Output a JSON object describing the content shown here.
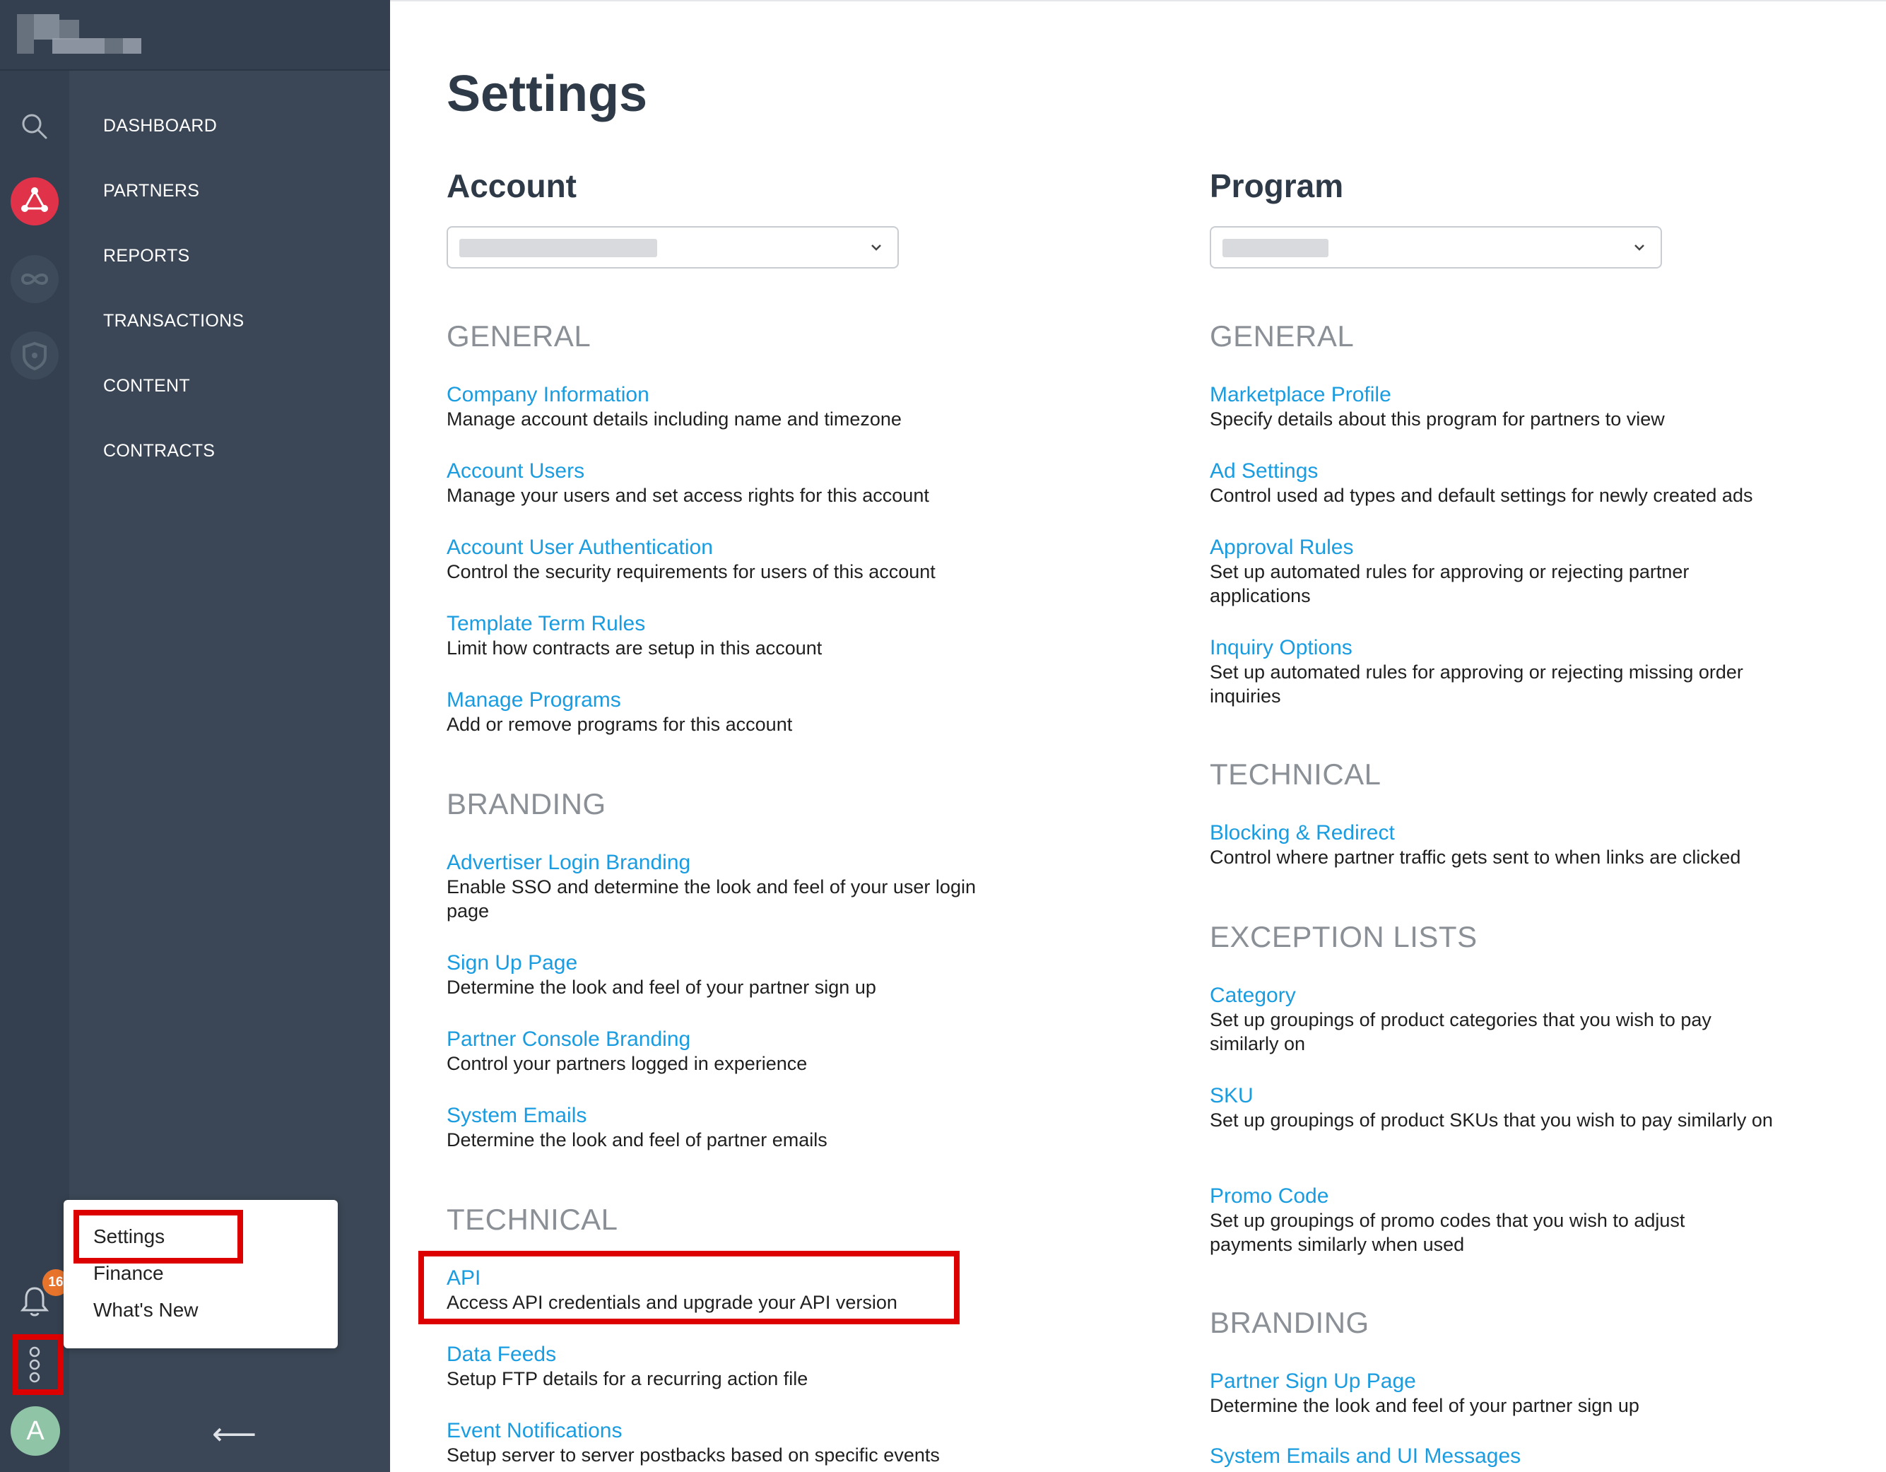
{
  "sidebar": {
    "nav_items": [
      "DASHBOARD",
      "PARTNERS",
      "REPORTS",
      "TRANSACTIONS",
      "CONTENT",
      "CONTRACTS"
    ],
    "notification_count": "16",
    "avatar_letter": "A",
    "collapse_arrow": "⟵",
    "icons": [
      "search-icon",
      "partners-network-icon",
      "infinity-icon",
      "shield-icon",
      "bell-icon",
      "more-options-icon"
    ],
    "accent_color": "#e0334a"
  },
  "popup_menu": {
    "items": [
      "Settings",
      "Finance",
      "What's New"
    ]
  },
  "page": {
    "title": "Settings"
  },
  "account": {
    "title": "Account",
    "sections": [
      {
        "heading": "GENERAL",
        "items": [
          {
            "link": "Company Information",
            "desc": "Manage account details including name and timezone"
          },
          {
            "link": "Account Users",
            "desc": "Manage your users and set access rights for this account"
          },
          {
            "link": "Account User Authentication",
            "desc": "Control the security requirements for users of this account"
          },
          {
            "link": "Template Term Rules",
            "desc": "Limit how contracts are setup in this account"
          },
          {
            "link": "Manage Programs",
            "desc": "Add or remove programs for this account"
          }
        ]
      },
      {
        "heading": "BRANDING",
        "items": [
          {
            "link": "Advertiser Login Branding",
            "desc": "Enable SSO and determine the look and feel of your user login page"
          },
          {
            "link": "Sign Up Page",
            "desc": "Determine the look and feel of your partner sign up"
          },
          {
            "link": "Partner Console Branding",
            "desc": "Control your partners logged in experience"
          },
          {
            "link": "System Emails",
            "desc": "Determine the look and feel of partner emails"
          }
        ]
      },
      {
        "heading": "TECHNICAL",
        "items": [
          {
            "link": "API",
            "desc": "Access API credentials and upgrade your API version"
          },
          {
            "link": "Data Feeds",
            "desc": "Setup FTP details for a recurring action file"
          },
          {
            "link": "Event Notifications",
            "desc": "Setup server to server postbacks based on specific events"
          }
        ]
      }
    ]
  },
  "program": {
    "title": "Program",
    "sections": [
      {
        "heading": "GENERAL",
        "items": [
          {
            "link": "Marketplace Profile",
            "desc": "Specify details about this program for partners to view"
          },
          {
            "link": "Ad Settings",
            "desc": "Control used ad types and default settings for newly created ads"
          },
          {
            "link": "Approval Rules",
            "desc": "Set up automated rules for approving or rejecting partner applications"
          },
          {
            "link": "Inquiry Options",
            "desc": "Set up automated rules for approving or rejecting missing order inquiries"
          }
        ]
      },
      {
        "heading": "TECHNICAL",
        "items": [
          {
            "link": "Blocking & Redirect",
            "desc": "Control where partner traffic gets sent to when links are clicked"
          }
        ]
      },
      {
        "heading": "EXCEPTION LISTS",
        "items": [
          {
            "link": "Category",
            "desc": "Set up groupings of product categories that you wish to pay similarly on"
          },
          {
            "link": "SKU",
            "desc": "Set up groupings of product SKUs that you wish to pay similarly on"
          },
          {
            "link": "Promo Code",
            "desc": "Set up groupings of promo codes that you wish to adjust payments similarly when used"
          }
        ]
      },
      {
        "heading": "BRANDING",
        "items": [
          {
            "link": "Partner Sign Up Page",
            "desc": "Determine the look and feel of your partner sign up"
          },
          {
            "link": "System Emails and UI Messages",
            "desc": ""
          }
        ]
      }
    ]
  },
  "colors": {
    "sidebar_dark": "#34404f",
    "sidebar_nav": "#3b4756",
    "link": "#1a9ce0",
    "highlight": "#dd0000"
  }
}
